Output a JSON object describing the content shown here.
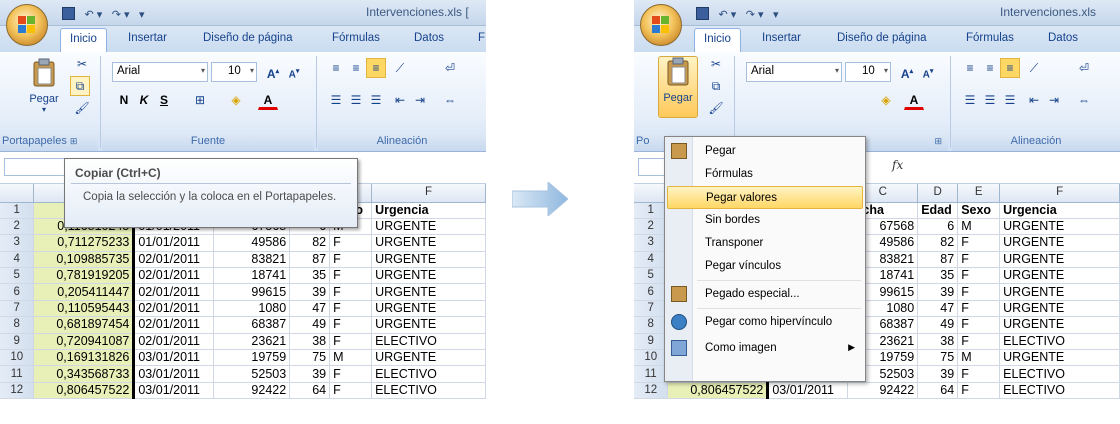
{
  "left": {
    "title": "Intervenciones.xls  [",
    "tabs": [
      "Inicio",
      "Insertar",
      "Diseño de página",
      "Fórmulas",
      "Datos",
      "F"
    ],
    "groups": {
      "clipboard": "Portapapeles",
      "font": "Fuente",
      "align": "Alineación"
    },
    "paste_label": "Pegar",
    "font_name": "Arial",
    "font_size": "10",
    "tooltip": {
      "title": "Copiar (Ctrl+C)",
      "body": "Copia la selección y la coloca en el Portapapeles."
    },
    "col_headers": [
      "E",
      "F"
    ],
    "header_row": {
      "e": "Sexo",
      "f": "Urgencia"
    },
    "rows": [
      {
        "n": "2",
        "a": "0,116810245",
        "b": "01/01/2011",
        "c": "67568",
        "d": "6",
        "e": "M",
        "f": "URGENTE"
      },
      {
        "n": "3",
        "a": "0,711275233",
        "b": "01/01/2011",
        "c": "49586",
        "d": "82",
        "e": "F",
        "f": "URGENTE"
      },
      {
        "n": "4",
        "a": "0,109885735",
        "b": "02/01/2011",
        "c": "83821",
        "d": "87",
        "e": "F",
        "f": "URGENTE"
      },
      {
        "n": "5",
        "a": "0,781919205",
        "b": "02/01/2011",
        "c": "18741",
        "d": "35",
        "e": "F",
        "f": "URGENTE"
      },
      {
        "n": "6",
        "a": "0,205411447",
        "b": "02/01/2011",
        "c": "99615",
        "d": "39",
        "e": "F",
        "f": "URGENTE"
      },
      {
        "n": "7",
        "a": "0,110595443",
        "b": "02/01/2011",
        "c": "1080",
        "d": "47",
        "e": "F",
        "f": "URGENTE"
      },
      {
        "n": "8",
        "a": "0,681897454",
        "b": "02/01/2011",
        "c": "68387",
        "d": "49",
        "e": "F",
        "f": "URGENTE"
      },
      {
        "n": "9",
        "a": "0,720941087",
        "b": "02/01/2011",
        "c": "23621",
        "d": "38",
        "e": "F",
        "f": "ELECTIVO"
      },
      {
        "n": "10",
        "a": "0,169131826",
        "b": "03/01/2011",
        "c": "19759",
        "d": "75",
        "e": "M",
        "f": "URGENTE"
      },
      {
        "n": "11",
        "a": "0,343568733",
        "b": "03/01/2011",
        "c": "52503",
        "d": "39",
        "e": "F",
        "f": "ELECTIVO"
      },
      {
        "n": "12",
        "a": "0,806457522",
        "b": "03/01/2011",
        "c": "92422",
        "d": "64",
        "e": "F",
        "f": "ELECTIVO"
      }
    ]
  },
  "right": {
    "title": "Intervenciones.xls",
    "tabs": [
      "Inicio",
      "Insertar",
      "Diseño de página",
      "Fórmulas",
      "Datos"
    ],
    "groups": {
      "clipboard": "Po",
      "align": "Alineación"
    },
    "paste_label": "Pegar",
    "font_name": "Arial",
    "font_size": "10",
    "fx": "fx",
    "menu": [
      "Pegar",
      "Fórmulas",
      "Pegar valores",
      "Sin bordes",
      "Transponer",
      "Pegar vínculos",
      "Pegado especial...",
      "Pegar como hipervínculo",
      "Como imagen"
    ],
    "col_headers": [
      "C",
      "D",
      "E",
      "F"
    ],
    "header_row": {
      "c": "Ficha",
      "d": "Edad",
      "e": "Sexo",
      "f": "Urgencia"
    },
    "tail_rows": [
      {
        "n": "9",
        "a": "0,720941087",
        "b": "02/01/2011"
      },
      {
        "n": "10",
        "a": "0,169131826",
        "b": "03/01/2011"
      },
      {
        "n": "11",
        "a": "0,343568733",
        "b": "03/01/2011"
      },
      {
        "n": "12",
        "a": "0,806457522",
        "b": "03/01/2011"
      }
    ]
  },
  "colors": {
    "selection": "#e8f0b8",
    "menu_highlight": "#ffd765",
    "ribbon": "#d2e0f3"
  }
}
